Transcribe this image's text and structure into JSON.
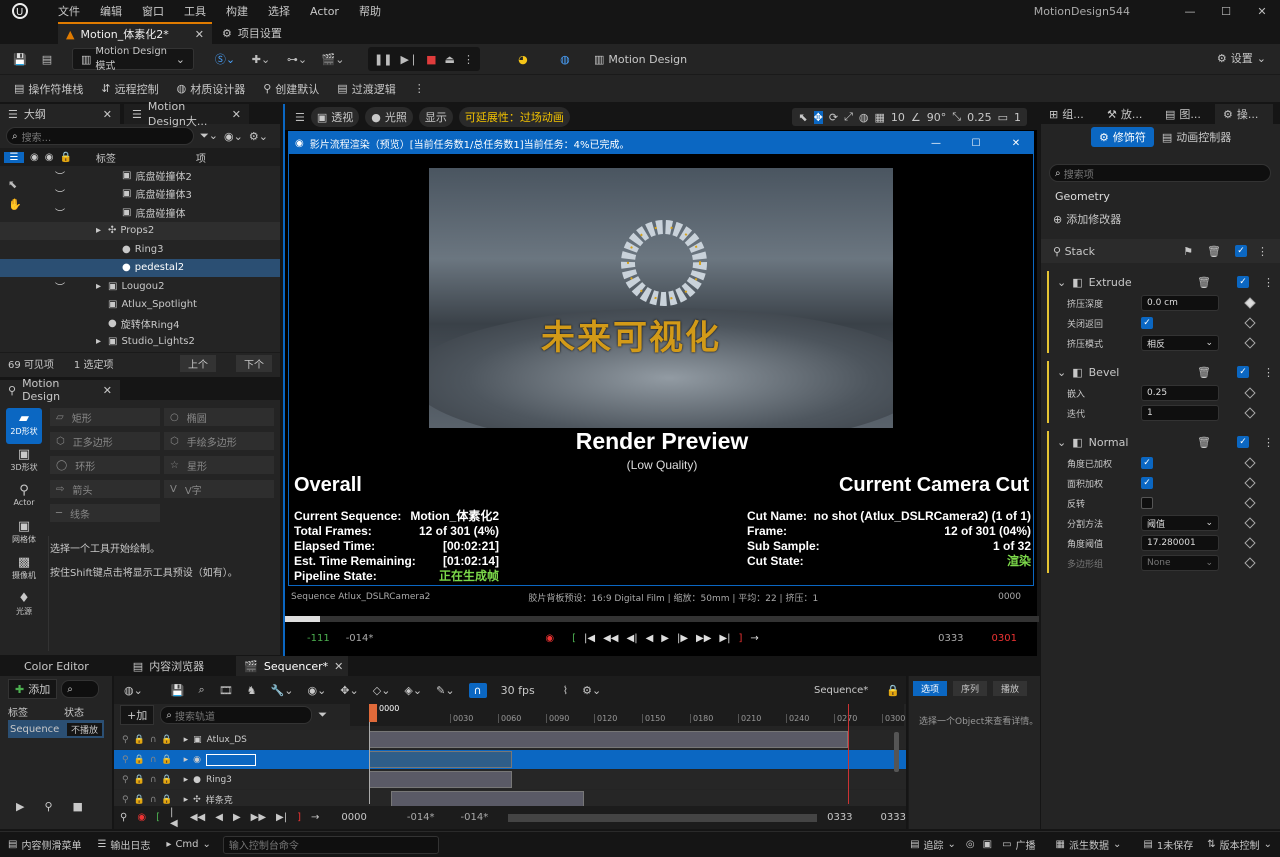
{
  "menubar": {
    "items": [
      "文件",
      "编辑",
      "窗口",
      "工具",
      "构建",
      "选择",
      "Actor",
      "帮助"
    ],
    "project": "MotionDesign544"
  },
  "tabs": {
    "level": "Motion_体素化2*",
    "project_settings": "项目设置"
  },
  "toolbar": {
    "mode": "Motion Design模式",
    "motion_design": "Motion Design",
    "settings": "设置"
  },
  "toolbar2": {
    "items": [
      "操作符堆栈",
      "远程控制",
      "材质设计器",
      "创建默认",
      "过渡逻辑"
    ]
  },
  "outliner": {
    "tab": "大纲",
    "search_placeholder": "搜索...",
    "col_label": "标签",
    "col_type": "项",
    "rows": [
      {
        "label": "底盘碰撞体2",
        "indent": 3
      },
      {
        "label": "底盘碰撞体3",
        "indent": 3
      },
      {
        "label": "底盘碰撞体",
        "indent": 3
      },
      {
        "label": "Props2",
        "indent": 2
      },
      {
        "label": "Ring3",
        "indent": 3
      },
      {
        "label": "pedestal2",
        "indent": 3,
        "selected": true
      },
      {
        "label": "Lougou2",
        "indent": 2
      },
      {
        "label": "Atlux_Spotlight",
        "indent": 2
      },
      {
        "label": "旋转体Ring4",
        "indent": 2
      },
      {
        "label": "Studio_Lights2",
        "indent": 2
      }
    ],
    "status_visible": "69 可见项",
    "status_selected": "1 选定项",
    "prev": "上个",
    "next": "下个"
  },
  "motion_design_tab": "Motion Design大...",
  "motion_panel": {
    "tab": "Motion Design",
    "categories": [
      "2D形状",
      "3D形状",
      "Actor",
      "网格体",
      "摄像机",
      "光源"
    ],
    "tools": [
      "矩形",
      "椭圆",
      "正多边形",
      "手绘多边形",
      "环形",
      "星形",
      "箭头",
      "V字",
      "线条"
    ],
    "hint1": "选择一个工具开始绘制。",
    "hint2": "按住Shift键点击将显示工具预设（如有）。"
  },
  "viewport": {
    "perspective": "透视",
    "lit": "光照",
    "show": "显示",
    "property": "可延展性：过场动画",
    "snap": "10",
    "angle": "90°",
    "scale": "0.25",
    "cam": "1"
  },
  "render_window": {
    "title": "影片流程渲染（预览）[当前任务数1/总任务数1]当前任务：4%已完成。",
    "logo_text": "未来可视化",
    "heading": "Render Preview",
    "subheading": "(Low Quality)",
    "overall": "Overall",
    "current_cut": "Current Camera Cut",
    "left_labels": [
      "Current Sequence:",
      "Total Frames:",
      "Elapsed Time:",
      "Est. Time Remaining:",
      "Pipeline State:"
    ],
    "left_values": [
      "Motion_体素化2",
      "12 of 301 (4%)",
      "[00:02:21]",
      "[01:02:14]",
      "正在生成帧"
    ],
    "right_labels": [
      "Cut Name:",
      "Frame:",
      "Sub Sample:",
      "Cut State:"
    ],
    "right_values": [
      "no shot (Atlux_DSLRCamera2) (1 of 1)",
      "12 of 301 (04%)",
      "1 of 32",
      "渲染"
    ]
  },
  "cam_info": {
    "sequence": "Sequence Atlux_DSLRCamera2",
    "film": "胶片背板预设：16:9 Digital Film | 缩放：50mm | 平均：22 | 挤压：1",
    "frame": "0000"
  },
  "transport": {
    "start_in": "-111",
    "start_out": "-014*",
    "end_in": "0333",
    "end_out": "0301"
  },
  "details": {
    "tabs": [
      "组...",
      "放...",
      "图...",
      "操..."
    ],
    "modifiers": "修饰符",
    "anim_controller": "动画控制器",
    "search_placeholder": "搜索项",
    "geometry": "Geometry",
    "add_modifier": "添加修改器",
    "stack": "Stack",
    "extrude": {
      "title": "Extrude",
      "rows": [
        {
          "label": "挤压深度",
          "value": "0.0 cm"
        },
        {
          "label": "关闭返回",
          "value": ""
        },
        {
          "label": "挤压模式",
          "value": "相反"
        }
      ]
    },
    "bevel": {
      "title": "Bevel",
      "rows": [
        {
          "label": "嵌入",
          "value": "0.25"
        },
        {
          "label": "迭代",
          "value": "1"
        }
      ]
    },
    "normal": {
      "title": "Normal",
      "rows": [
        {
          "label": "角度已加权",
          "value": ""
        },
        {
          "label": "面积加权",
          "value": ""
        },
        {
          "label": "反转",
          "value": ""
        },
        {
          "label": "分割方法",
          "value": "阈值"
        },
        {
          "label": "角度阈值",
          "value": "17.280001"
        },
        {
          "label": "多边形组",
          "value": "None"
        }
      ]
    }
  },
  "bottom_tabs": {
    "color_editor": "Color Editor",
    "content_browser": "内容浏览器",
    "sequencer": "Sequencer*"
  },
  "sequencer": {
    "add": "添加",
    "col_label": "标签",
    "col_state": "状态",
    "seq_name": "Sequence",
    "seq_state": "不播放",
    "add_track": "+加",
    "search_placeholder": "搜索轨道",
    "fps": "30 fps",
    "name": "Sequence*",
    "ticks": [
      "0000",
      "0030",
      "0060",
      "0090",
      "0120",
      "0150",
      "0180",
      "0210",
      "0240",
      "0270",
      "0300"
    ],
    "tracks": [
      "Atlux_DS",
      "",
      "Ring3",
      "样条克"
    ],
    "detail_tabs": [
      "选项",
      "序列",
      "播放"
    ],
    "detail_hint": "选择一个Object来查看详情。",
    "frame": "0000",
    "range_a": "-014*",
    "range_b": "-014*",
    "end_a": "0333",
    "end_b": "0333"
  },
  "statusbar": {
    "content_drawer": "内容侧滑菜单",
    "output_log": "输出日志",
    "cmd": "Cmd",
    "cmd_placeholder": "输入控制台命令",
    "trace": "追踪",
    "broadcast": "广播",
    "derived": "派生数据",
    "unsaved": "1未保存",
    "source_control": "版本控制"
  }
}
